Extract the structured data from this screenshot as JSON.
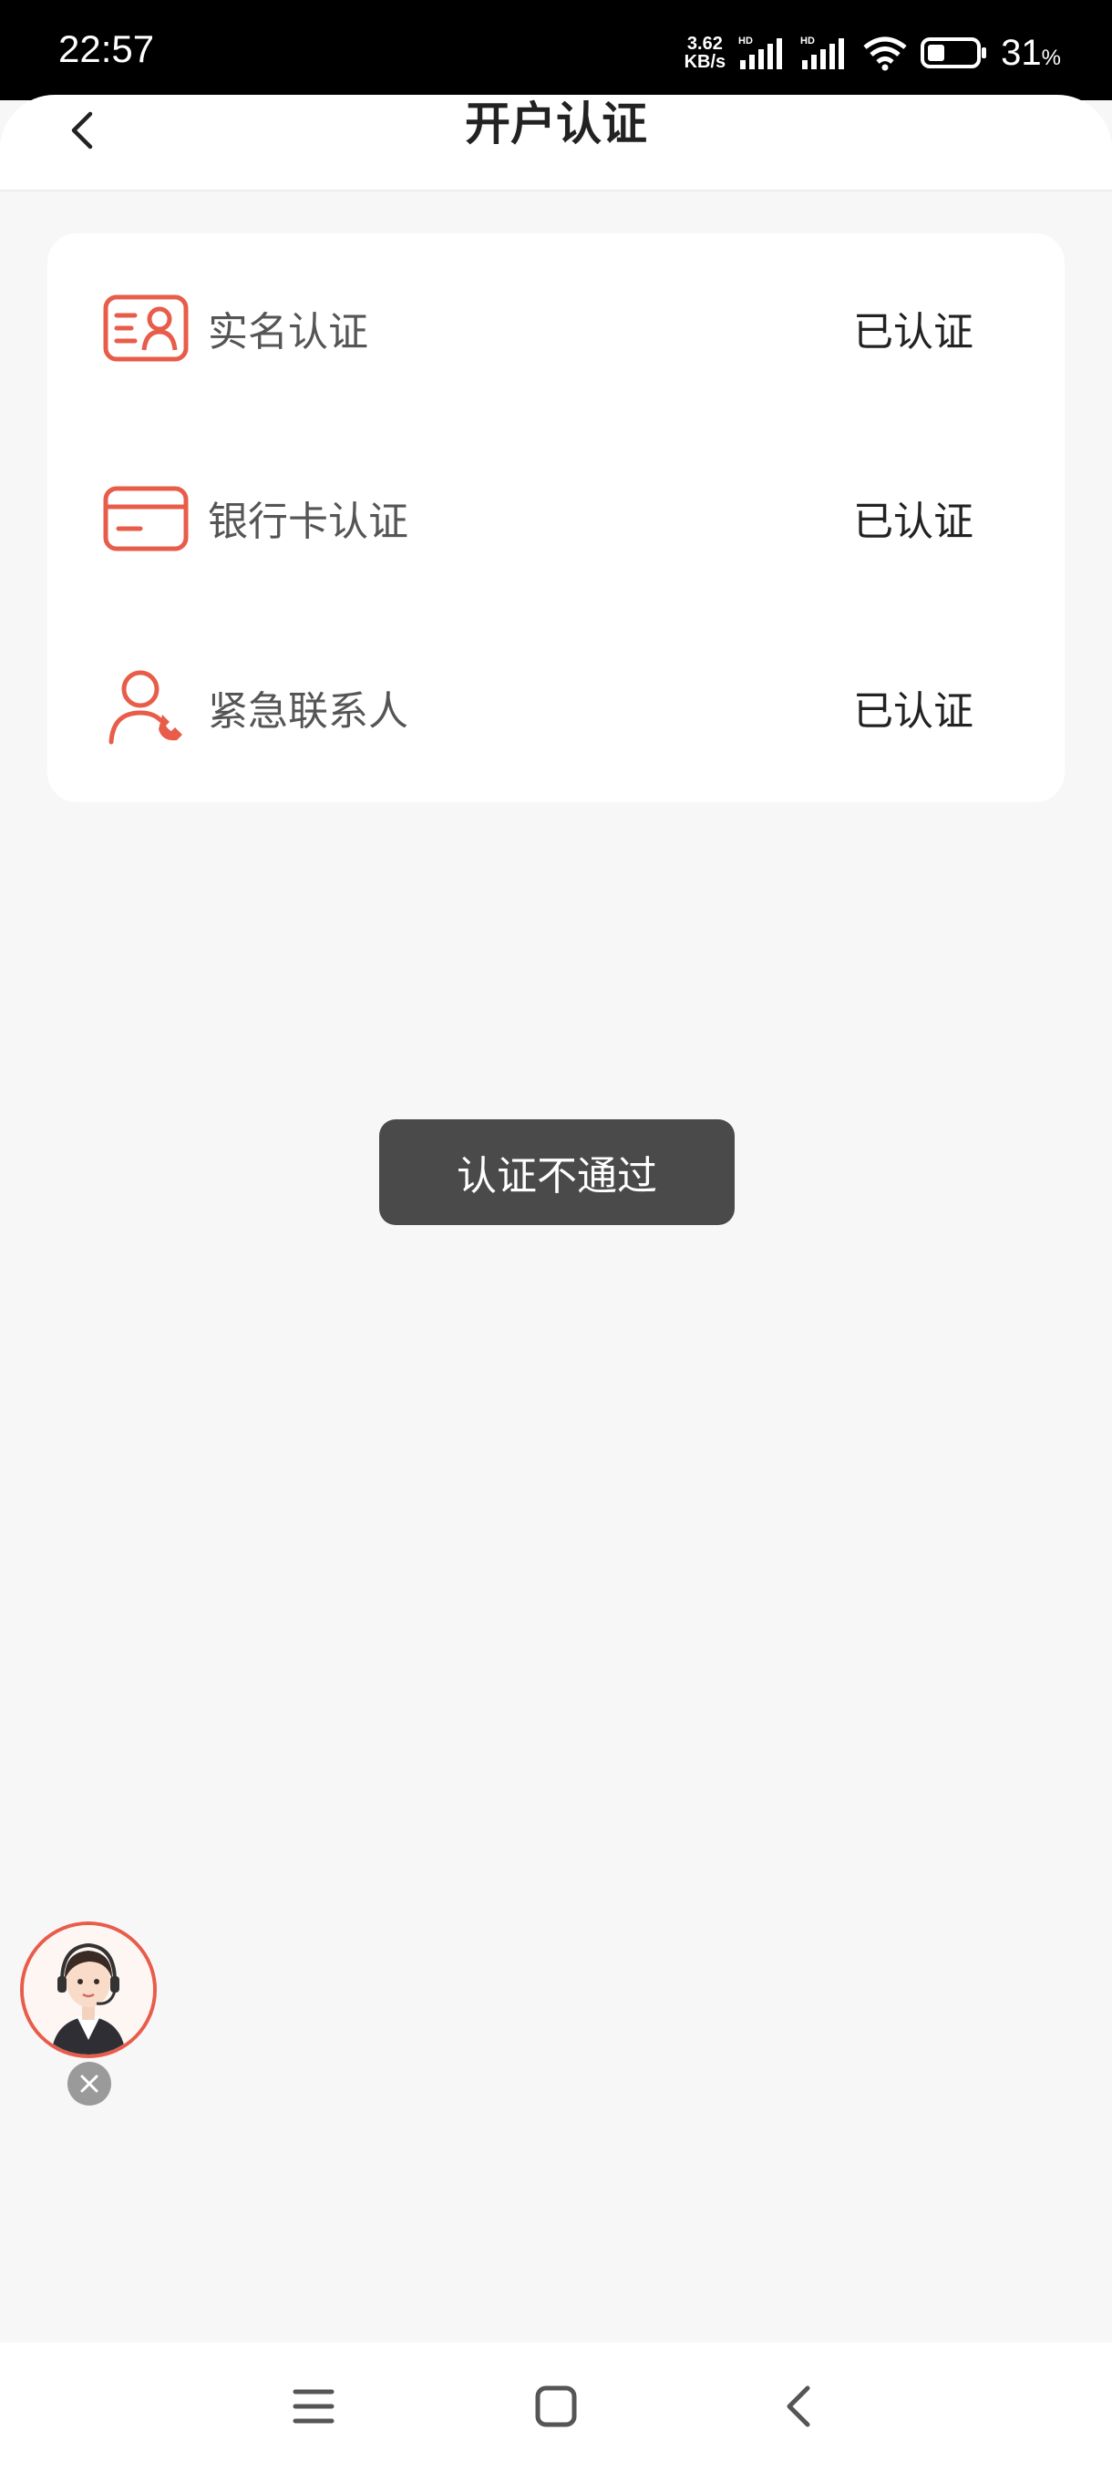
{
  "status_bar": {
    "time": "22:57",
    "net_speed_value": "3.62",
    "net_speed_unit": "KB/s",
    "battery_percent": "31",
    "battery_unit": "%"
  },
  "header": {
    "title": "开户认证",
    "back_icon": "chevron-left-icon"
  },
  "verification_items": [
    {
      "label": "实名认证",
      "status": "已认证",
      "icon": "id-card-icon"
    },
    {
      "label": "银行卡认证",
      "status": "已认证",
      "icon": "bank-card-icon"
    },
    {
      "label": "紧急联系人",
      "status": "已认证",
      "icon": "contact-phone-icon"
    }
  ],
  "toast": {
    "message": "认证不通过"
  },
  "colors": {
    "accent": "#e85c4a",
    "background": "#f7f7f7",
    "toast_bg": "#4a4a4a"
  },
  "system_nav": {
    "icons": [
      "menu-icon",
      "home-icon",
      "back-icon"
    ]
  }
}
